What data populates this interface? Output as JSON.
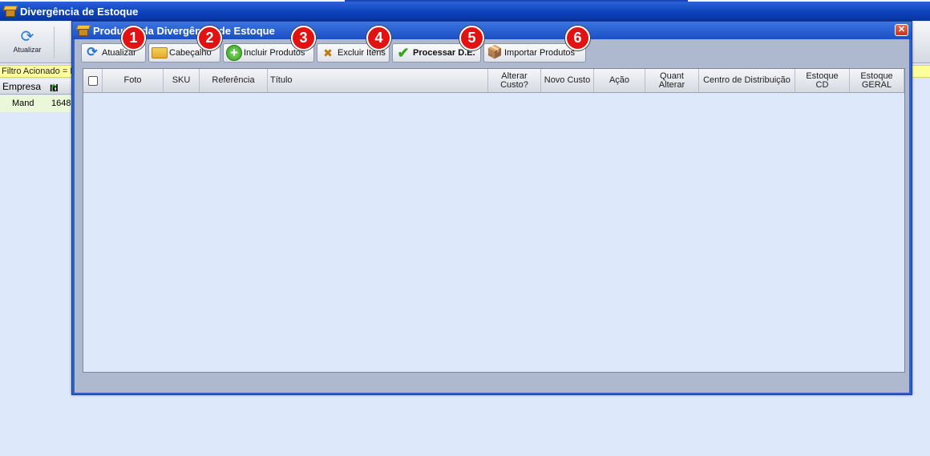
{
  "main": {
    "title": "Divergência de Estoque",
    "toolbar_refresh": "Atualizar",
    "filter_text": "Filtro Acionado = I",
    "grid_cols": [
      "Empresa",
      "Id"
    ],
    "row": [
      "Mand",
      "1648"
    ]
  },
  "dialog": {
    "title": "Produtos da Divergência de Estoque",
    "close": "✕",
    "toolbar": [
      {
        "label": "Atualizar",
        "badge": "1"
      },
      {
        "label": "Cabeçalho",
        "badge": "2"
      },
      {
        "label": "Incluir Produtos",
        "badge": "3"
      },
      {
        "label": "Excluir Itens",
        "badge": "4"
      },
      {
        "label": "Processar D.E.",
        "badge": "5"
      },
      {
        "label": "Importar Produtos",
        "badge": "6"
      }
    ],
    "columns": [
      "Foto",
      "SKU",
      "Referência",
      "Título",
      "Alterar\nCusto?",
      "Novo Custo",
      "Ação",
      "Quant\nAlterar",
      "Centro de Distribuição",
      "Estoque\nCD",
      "Estoque\nGERAL"
    ]
  }
}
